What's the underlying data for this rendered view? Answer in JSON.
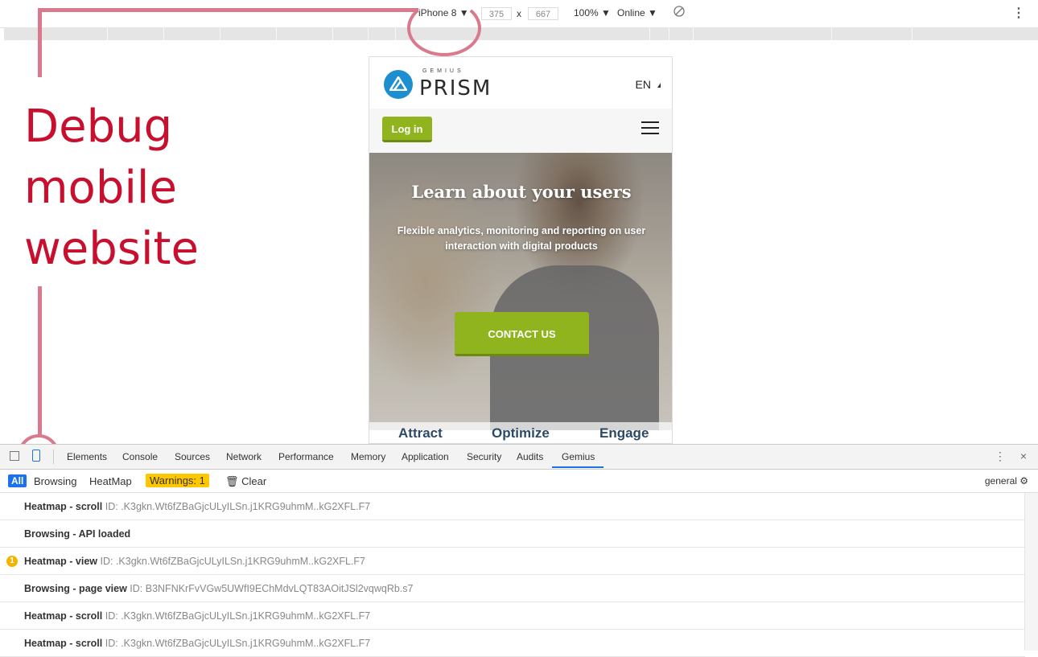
{
  "device_toolbar": {
    "device": "iPhone 8 ▼",
    "width": "375",
    "times": "x",
    "height": "667",
    "zoom": "100% ▼",
    "network": "Online ▼",
    "kebab": "⋮"
  },
  "annotation": {
    "lines": [
      "Debug",
      "mobile",
      "website"
    ],
    "color": "#c8102e"
  },
  "site": {
    "logo_small": "GEMIUS",
    "logo_text": "PRISM",
    "lang": "EN",
    "login_label": "Log in",
    "hero_title": "Learn about your users",
    "hero_subtitle": "Flexible analytics, monitoring and reporting on user interaction with digital products",
    "contact_label": "CONTACT US",
    "features": [
      "Attract",
      "Optimize",
      "Engage"
    ],
    "accent": "#8fb41e"
  },
  "devtools": {
    "tabs": [
      "Elements",
      "Console",
      "Sources",
      "Network",
      "Performance",
      "Memory",
      "Application",
      "Security",
      "Audits",
      "Gemius"
    ],
    "active_tab": "Gemius",
    "close": "×",
    "more": "⋮",
    "filters": {
      "all": "All",
      "browsing": "Browsing",
      "heatmap": "HeatMap",
      "warnings": "Warnings: 1",
      "clear": "🗑 Clear",
      "general": "general ⚙"
    },
    "log": [
      {
        "label": "Heatmap - scroll",
        "id": "ID: .K3gkn.Wt6fZBaGjcULyILSn.j1KRG9uhmM..kG2XFL.F7",
        "badge": ""
      },
      {
        "label": "Browsing - API loaded",
        "id": "",
        "badge": ""
      },
      {
        "label": "Heatmap - view",
        "id": "ID: .K3gkn.Wt6fZBaGjcULyILSn.j1KRG9uhmM..kG2XFL.F7",
        "badge": "1"
      },
      {
        "label": "Browsing - page view",
        "id": "ID: B3NFNKrFvVGw5UWfI9EChMdvLQT83AOitJSl2vqwqRb.s7",
        "badge": ""
      },
      {
        "label": "Heatmap - scroll",
        "id": "ID: .K3gkn.Wt6fZBaGjcULyILSn.j1KRG9uhmM..kG2XFL.F7",
        "badge": ""
      },
      {
        "label": "Heatmap - scroll",
        "id": "ID: .K3gkn.Wt6fZBaGjcULyILSn.j1KRG9uhmM..kG2XFL.F7",
        "badge": ""
      }
    ]
  }
}
